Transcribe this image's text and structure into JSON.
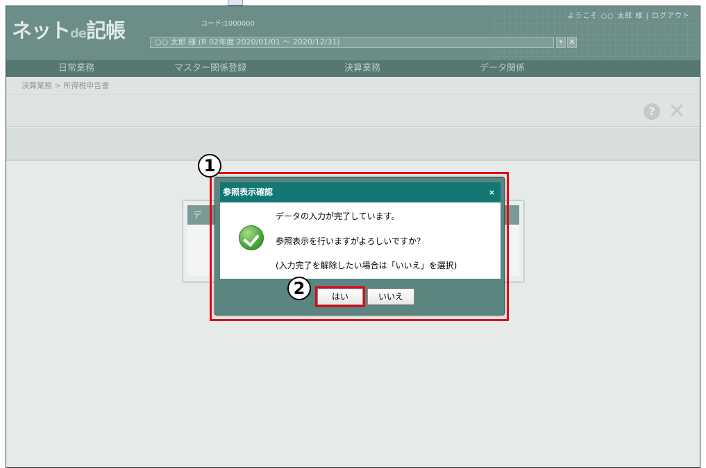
{
  "app": {
    "logo_main": "ネット",
    "logo_de": "de",
    "logo_tail": "記帳",
    "code_label": "コード:1000000",
    "user_select_value": "○○ 太郎 様 (R 02年度 2020/01/01 ～ 2020/12/31)",
    "top_links": "ようこそ ○○ 太郎 様 | ログアウト",
    "select_arrow_glyph": "▾",
    "select_close_glyph": "✕"
  },
  "menu": {
    "items": [
      "日常業務",
      "マスター関係登録",
      "決算業務",
      "データ関係"
    ]
  },
  "breadcrumb": "決算業務 > 所得税申告書",
  "toolbar": {
    "help_glyph": "?",
    "close_glyph": "✕"
  },
  "background_dialog": {
    "title": "デ"
  },
  "modal": {
    "title": "参照表示確認",
    "close_glyph": "×",
    "messages": [
      "データの入力が完了しています。",
      "参照表示を行いますがよろしいですか？",
      "(入力完了を解除したい場合は「いいえ」を選択)"
    ],
    "yes_label": "はい",
    "no_label": "いいえ"
  },
  "annotations": {
    "badge_1": "1",
    "badge_2": "2",
    "highlight_color": "#e60012"
  },
  "colors": {
    "header": "#6c8d88",
    "menubar": "#567772",
    "modal_title": "#137773",
    "modal_frame": "#5a8580"
  }
}
